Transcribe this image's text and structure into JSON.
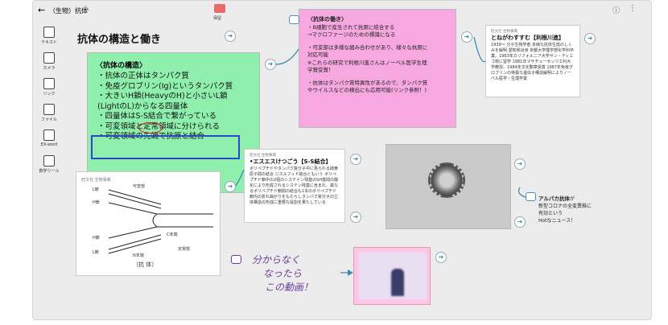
{
  "app": {
    "title": "（生物）抗体",
    "folder_label": "保留"
  },
  "tools": [
    {
      "label": "テキスト",
      "icon": "text-icon"
    },
    {
      "label": "カメラ",
      "icon": "camera-icon"
    },
    {
      "label": "リンク",
      "icon": "link-icon"
    },
    {
      "label": "ファイル",
      "icon": "file-icon"
    },
    {
      "label": "EX-word",
      "icon": "exword-icon"
    },
    {
      "label": "数学ツール",
      "icon": "math-tool-icon"
    }
  ],
  "board_title": "抗体の構造と働き",
  "green_note": {
    "heading": "〈抗体の構造〉",
    "lines": [
      "・抗体の正体はタンパク質",
      "・免疫グロブリン(Ig)というタンパク質",
      "・大きいH鎖(HeavyのH)と小さいL鎖",
      "(LightのL)からなる四量体",
      "・四量体はS-S結合で繋がっている",
      "・可変領域と定常領域に分けられる",
      "・可変領域の先端で抗原と結合"
    ]
  },
  "pink_note": {
    "heading": "〈抗体の働き〉",
    "lines": [
      "・B細胞で産生されて抗原に結合する",
      "→マクロファージのための標識になる",
      "",
      "・可変部は多様な組み合わせがあり、様々な抗原に",
      "対応可能",
      "※これらの研究で利根川進さんはノーベル医学生理",
      "学賞受賞！",
      "",
      "・抗体はタンパク質特異性があるので、タンパク質",
      "やウイルスなどの検出にも応用可能(リンク参照！)"
    ]
  },
  "card_tonegawa": {
    "publisher": "旺文社 生物事典",
    "keyword": "とねがわすすむ【利根川進】",
    "body": "1939～ 分子生物学者 多様な抗体生成のしくみを解明 愛知県出身 京都大学理学部化学科卒 業。1963年カリフォルニア大学サン・ディエゴ校に留学 1981年マサチューセッツ工科大学教授。1984年文化勲章受賞 1987年免疫グロブリンの特異な遺伝子構造解明によりノーベル医学・生理学賞"
  },
  "card_ss": {
    "publisher": "旺文社 生物事典",
    "keyword": "•エスエスけつごう【S-S結合】",
    "body": "ポリペプチドやタンパク質分子中に見られる硫黄原子間の結合 ジスルフィド結合ともいう ポリペプチド鎖中の2個のシステイン残基のSH基間の酸化により形成されるシステン残基に含まれ、異なるポリペプチド鎖間の結合も1本のポリペプチド鎖内の折れ曲がりをもたらしタンパク質分子の立体構造の形成に重要な役割を果たしている"
  },
  "diagram": {
    "publisher": "旺文社 生物事典",
    "labels": [
      "可変部",
      "L鎖",
      "H鎖",
      "H鎖",
      "L鎖",
      "C末端",
      "N末端",
      "定常部"
    ],
    "caption": "〔抗 体〕"
  },
  "alpaca": {
    "title": "アルパカ抗体",
    "suffix": "が",
    "lines": [
      "新型コロナの全変異株に",
      "有効という",
      "Hotなニュース！"
    ]
  },
  "handwriting": [
    "分からなく",
    "なったら",
    "この動画！"
  ],
  "colors": {
    "green_note": "#8ff0ae",
    "pink_note": "#f7a8e0",
    "connector": "#3a8fb0",
    "highlight_box": "#2a48c8",
    "circle": "#dd1122"
  }
}
